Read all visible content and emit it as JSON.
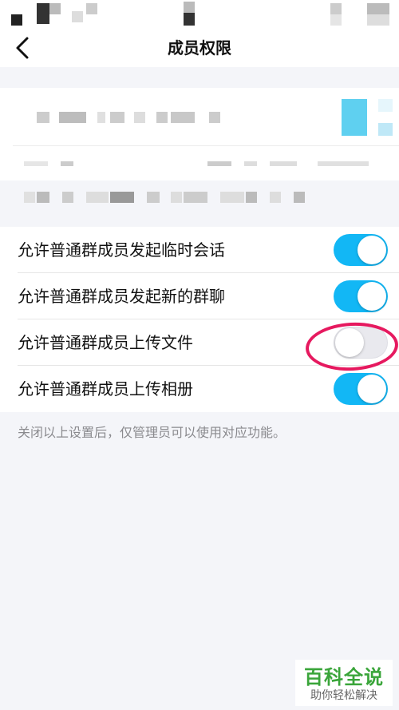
{
  "header": {
    "title": "成员权限",
    "back_icon": "chevron-left-icon"
  },
  "settings": [
    {
      "label": "允许普通群成员发起临时会话",
      "enabled": true
    },
    {
      "label": "允许普通群成员发起新的群聊",
      "enabled": true
    },
    {
      "label": "允许普通群成员上传文件",
      "enabled": false
    },
    {
      "label": "允许普通群成员上传相册",
      "enabled": true
    }
  ],
  "footnote": "关闭以上设置后，仅管理员可以使用对应功能。",
  "watermark": {
    "title": "百科全说",
    "subtitle": "助你轻松解决"
  },
  "colors": {
    "toggle_on": "#12b7f5",
    "toggle_off": "#e9e9ee",
    "annotation": "#e6195f",
    "watermark": "#3aa53a"
  }
}
